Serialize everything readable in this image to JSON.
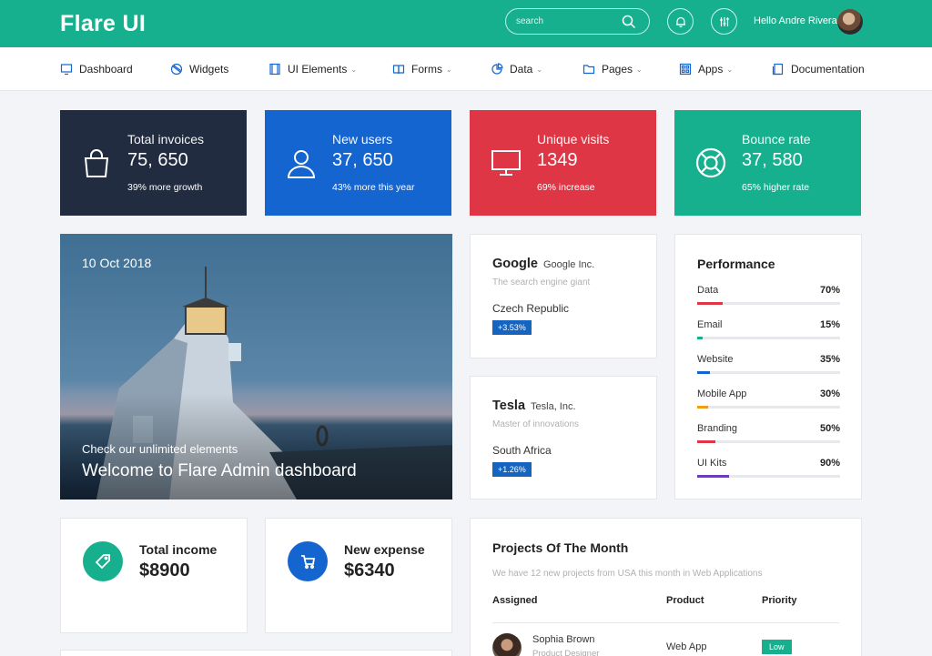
{
  "header": {
    "brand": "Flare UI",
    "search_placeholder": "search",
    "greeting": "Hello Andre Rivera"
  },
  "nav": {
    "items": [
      {
        "label": "Dashboard",
        "icon": "monitor-icon",
        "dropdown": false
      },
      {
        "label": "Widgets",
        "icon": "widgets-icon",
        "dropdown": false
      },
      {
        "label": "UI Elements",
        "icon": "film-icon",
        "dropdown": true
      },
      {
        "label": "Forms",
        "icon": "book-icon",
        "dropdown": true
      },
      {
        "label": "Data",
        "icon": "pie-icon",
        "dropdown": true
      },
      {
        "label": "Pages",
        "icon": "folder-icon",
        "dropdown": true
      },
      {
        "label": "Apps",
        "icon": "grid-icon",
        "dropdown": true
      },
      {
        "label": "Documentation",
        "icon": "document-icon",
        "dropdown": false
      }
    ]
  },
  "stats": [
    {
      "title": "Total invoices",
      "value": "75, 650",
      "sub": "39% more growth",
      "color": "#212c40",
      "icon": "shopping-bag-icon"
    },
    {
      "title": "New users",
      "value": "37, 650",
      "sub": "43% more this year",
      "color": "#1565d0",
      "icon": "user-icon"
    },
    {
      "title": "Unique visits",
      "value": "1349",
      "sub": "69% increase",
      "color": "#df3646",
      "icon": "monitor-icon"
    },
    {
      "title": "Bounce rate",
      "value": "37, 580",
      "sub": "65% higher rate",
      "color": "#17b08f",
      "icon": "lifebuoy-icon"
    }
  ],
  "hero": {
    "date": "10 Oct 2018",
    "subtitle": "Check our unlimited elements",
    "title": "Welcome to Flare Admin dashboard"
  },
  "companies": [
    {
      "name": "Google",
      "inc": "Google Inc.",
      "tagline": "The search engine giant",
      "country": "Czech Republic",
      "badge": "+3.53%"
    },
    {
      "name": "Tesla",
      "inc": "Tesla, Inc.",
      "tagline": "Master of innovations",
      "country": "South Africa",
      "badge": "+1.26%"
    }
  ],
  "performance": {
    "title": "Performance",
    "items": [
      {
        "label": "Data",
        "value_label": "70%",
        "color": "#df3646"
      },
      {
        "label": "Email",
        "value_label": "15%",
        "color": "#17b08f"
      },
      {
        "label": "Website",
        "value_label": "35%",
        "color": "#1565d0"
      },
      {
        "label": "Mobile App",
        "value_label": "30%",
        "color": "#f39c12"
      },
      {
        "label": "Branding",
        "value_label": "50%",
        "color": "#df3646"
      },
      {
        "label": "UI Kits",
        "value_label": "90%",
        "color": "#6a3fb5"
      }
    ]
  },
  "income": {
    "title": "Total income",
    "value": "$8900",
    "color": "#17b08f"
  },
  "expense": {
    "title": "New expense",
    "value": "$6340",
    "color": "#1565d0"
  },
  "projects": {
    "title": "Projects Of The Month",
    "description": "We have 12 new projects from USA this month in Web Applications",
    "columns": [
      "Assigned",
      "Product",
      "Priority"
    ],
    "rows": [
      {
        "name": "Sophia Brown",
        "role": "Product Designer",
        "product": "Web App",
        "priority": "Low"
      }
    ]
  }
}
